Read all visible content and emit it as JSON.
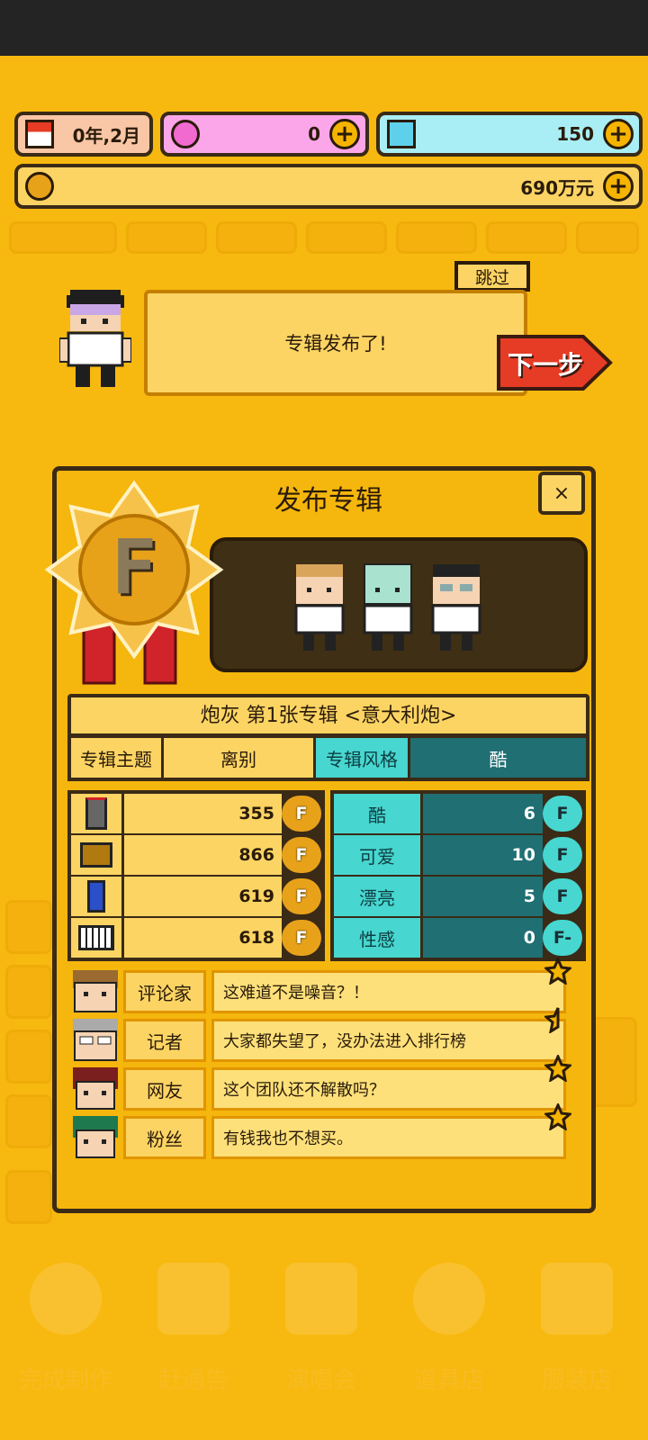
{
  "hud": {
    "date": "0年,2月",
    "pink_currency": "0",
    "diamond": "150",
    "money": "690万元"
  },
  "tutorial": {
    "skip": "跳过",
    "message": "专辑发布了!",
    "next": "下一步"
  },
  "panel": {
    "title": "发布专辑",
    "close": "×",
    "rank": "F",
    "album_title": "炮灰 第1张专辑 <意大利炮>",
    "theme_label": "专辑主题",
    "theme_value": "离别",
    "style_label": "专辑风格",
    "style_value": "酷",
    "left_stats": [
      {
        "icon": "microphone-icon",
        "value": "355",
        "grade": "F"
      },
      {
        "icon": "boot-icon",
        "value": "866",
        "grade": "F"
      },
      {
        "icon": "pen-icon",
        "value": "619",
        "grade": "F"
      },
      {
        "icon": "keyboard-icon",
        "value": "618",
        "grade": "F"
      }
    ],
    "right_stats": [
      {
        "label": "酷",
        "value": "6",
        "grade": "F"
      },
      {
        "label": "可爱",
        "value": "10",
        "grade": "F"
      },
      {
        "label": "漂亮",
        "value": "5",
        "grade": "F"
      },
      {
        "label": "性感",
        "value": "0",
        "grade": "F-"
      }
    ],
    "reviews": [
      {
        "who": "评论家",
        "text": "这难道不是噪音？！"
      },
      {
        "who": "记者",
        "text": "大家都失望了，没办法进入排行榜"
      },
      {
        "who": "网友",
        "text": "这个团队还不解散吗？"
      },
      {
        "who": "粉丝",
        "text": "有钱我也不想买。"
      }
    ]
  },
  "bottom_nav": [
    "完成制作",
    "赶通告",
    "演唱会",
    "道具店",
    "服装店"
  ],
  "colors": {
    "background": "#f7b90f",
    "teal": "#1f6f73",
    "cyan": "#47d6d0",
    "red_button": "#e63b25"
  }
}
